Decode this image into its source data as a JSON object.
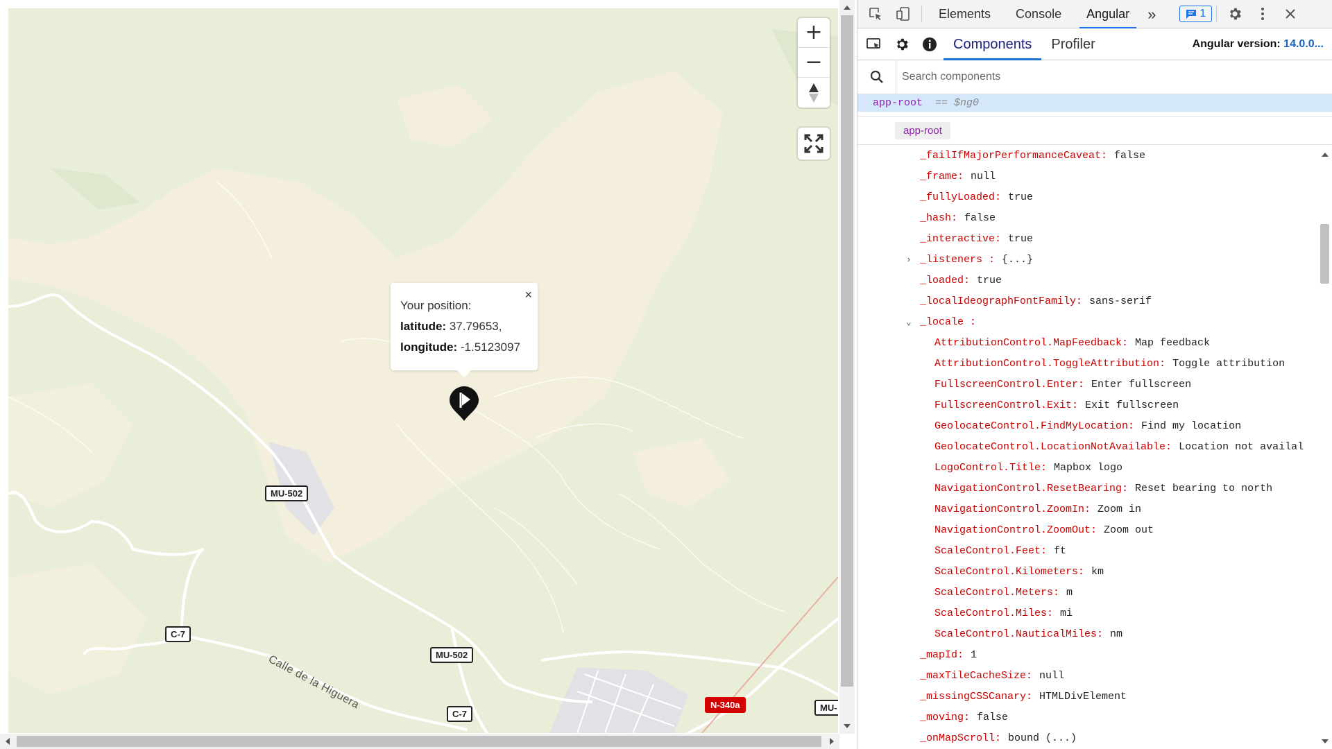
{
  "map": {
    "popup": {
      "title": "Your position:",
      "latitude_label": "latitude:",
      "latitude_value": "37.79653,",
      "longitude_label": "longitude:",
      "longitude_value": "-1.5123097",
      "close": "×"
    },
    "controls": {
      "zoom_in": "+",
      "zoom_out": "−"
    },
    "road_shields": {
      "mu502_a": "MU-502",
      "mu502_b": "MU-502",
      "c7_a": "C-7",
      "c7_b": "C-7",
      "n340a": "N-340a",
      "mu_edge": "MU-"
    },
    "street": "Calle de la Higuera",
    "colors": {
      "land": "#e9eed9",
      "urban": "#f4efdc",
      "shield_red": "#d40000"
    }
  },
  "devtools": {
    "tabs": [
      "Elements",
      "Console",
      "Angular"
    ],
    "active_tab": "Angular",
    "more": "»",
    "issues_count": "1",
    "angular": {
      "tabs": [
        "Components",
        "Profiler"
      ],
      "version_label": "Angular version:",
      "version_value": "14.0.0..."
    },
    "search": {
      "placeholder": "Search components"
    },
    "tree": {
      "root": "app-root",
      "ng0": "== $ng0"
    },
    "breadcrumb": "app-root",
    "properties": [
      {
        "key": "_failIfMajorPerformanceCaveat:",
        "value": "false",
        "level": 0
      },
      {
        "key": "_frame:",
        "value": "null",
        "level": 0
      },
      {
        "key": "_fullyLoaded:",
        "value": "true",
        "level": 0
      },
      {
        "key": "_hash:",
        "value": "false",
        "level": 0
      },
      {
        "key": "_interactive:",
        "value": "true",
        "level": 0
      },
      {
        "key": "_listeners :",
        "value": "{...}",
        "level": 0,
        "caret": "›"
      },
      {
        "key": "_loaded:",
        "value": "true",
        "level": 0
      },
      {
        "key": "_localIdeographFontFamily:",
        "value": "sans-serif",
        "level": 0
      },
      {
        "key": "_locale :",
        "value": "",
        "level": 0,
        "caret": "⌄"
      },
      {
        "key": "AttributionControl.MapFeedback:",
        "value": "Map feedback",
        "level": 1
      },
      {
        "key": "AttributionControl.ToggleAttribution:",
        "value": "Toggle attribution",
        "level": 1
      },
      {
        "key": "FullscreenControl.Enter:",
        "value": "Enter fullscreen",
        "level": 1
      },
      {
        "key": "FullscreenControl.Exit:",
        "value": "Exit fullscreen",
        "level": 1
      },
      {
        "key": "GeolocateControl.FindMyLocation:",
        "value": "Find my location",
        "level": 1
      },
      {
        "key": "GeolocateControl.LocationNotAvailable:",
        "value": "Location not availal",
        "level": 1
      },
      {
        "key": "LogoControl.Title:",
        "value": "Mapbox logo",
        "level": 1
      },
      {
        "key": "NavigationControl.ResetBearing:",
        "value": "Reset bearing to north",
        "level": 1
      },
      {
        "key": "NavigationControl.ZoomIn:",
        "value": "Zoom in",
        "level": 1
      },
      {
        "key": "NavigationControl.ZoomOut:",
        "value": "Zoom out",
        "level": 1
      },
      {
        "key": "ScaleControl.Feet:",
        "value": "ft",
        "level": 1
      },
      {
        "key": "ScaleControl.Kilometers:",
        "value": "km",
        "level": 1
      },
      {
        "key": "ScaleControl.Meters:",
        "value": "m",
        "level": 1
      },
      {
        "key": "ScaleControl.Miles:",
        "value": "mi",
        "level": 1
      },
      {
        "key": "ScaleControl.NauticalMiles:",
        "value": "nm",
        "level": 1
      },
      {
        "key": "_mapId:",
        "value": "1",
        "level": 0
      },
      {
        "key": "_maxTileCacheSize:",
        "value": "null",
        "level": 0
      },
      {
        "key": "_missingCSSCanary:",
        "value": "HTMLDivElement",
        "level": 0
      },
      {
        "key": "_moving:",
        "value": "false",
        "level": 0
      },
      {
        "key": "_onMapScroll:",
        "value": "bound (...)",
        "level": 0
      }
    ]
  }
}
